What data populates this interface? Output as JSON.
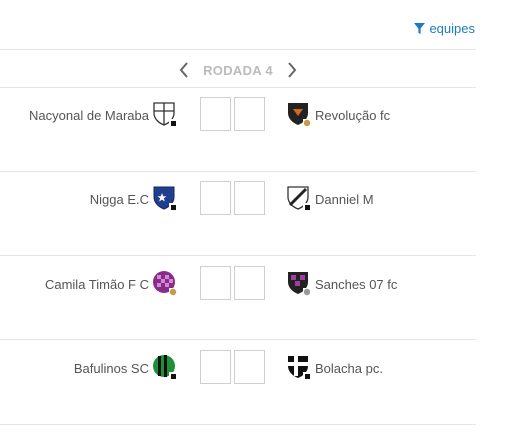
{
  "filter": {
    "label": "equipes",
    "icon": "filter-icon"
  },
  "round": {
    "label": "RODADA 4",
    "prev_icon": "chevron-left-icon",
    "next_icon": "chevron-right-icon"
  },
  "matches": [
    {
      "home": {
        "name": "Nacyonal de Maraba",
        "shield_icon": "team-shield-icon",
        "colors": [
          "#ffffff",
          "#222222"
        ]
      },
      "away": {
        "name": "Revolução fc",
        "shield_icon": "team-shield-icon",
        "colors": [
          "#222222",
          "#d2691e"
        ]
      },
      "home_score": "",
      "away_score": ""
    },
    {
      "home": {
        "name": "Nigga E.C",
        "shield_icon": "team-shield-icon",
        "colors": [
          "#1f3f8f",
          "#ffffff"
        ]
      },
      "away": {
        "name": "Danniel M",
        "shield_icon": "team-shield-icon",
        "colors": [
          "#ffffff",
          "#222222"
        ]
      },
      "home_score": "",
      "away_score": ""
    },
    {
      "home": {
        "name": "Camila Timão F C",
        "shield_icon": "team-shield-icon",
        "colors": [
          "#8a2a8a",
          "#d08ad0"
        ]
      },
      "away": {
        "name": "Sanches 07 fc",
        "shield_icon": "team-shield-icon",
        "colors": [
          "#6b1f6b",
          "#222222"
        ]
      },
      "home_score": "",
      "away_score": ""
    },
    {
      "home": {
        "name": "Bafulinos SC",
        "shield_icon": "team-shield-icon",
        "colors": [
          "#1f8f3a",
          "#111111"
        ]
      },
      "away": {
        "name": "Bolacha pc.",
        "shield_icon": "team-shield-icon",
        "colors": [
          "#111111",
          "#ffffff"
        ]
      },
      "home_score": "",
      "away_score": ""
    }
  ]
}
